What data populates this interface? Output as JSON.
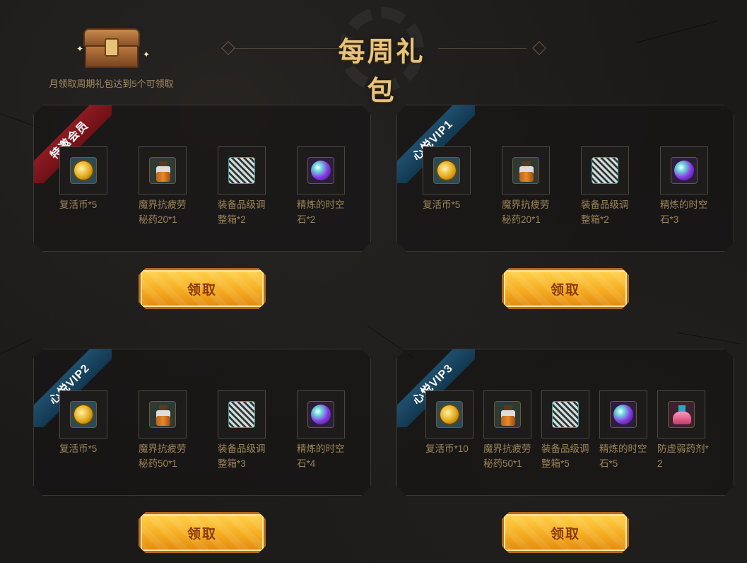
{
  "header": {
    "title": "每周礼包",
    "chest_note": "月领取周期礼包达到5个可领取"
  },
  "panels": [
    {
      "ribbon": "特邀会员",
      "ribbon_color": "#8e1b22",
      "items": [
        {
          "icon": "revive-coin-icon",
          "label": "复活币*5"
        },
        {
          "icon": "potion-icon",
          "label": "魔界抗疲劳秘药20*1"
        },
        {
          "icon": "gear-box-icon",
          "label": "装备品级调整箱*2"
        },
        {
          "icon": "time-stone-icon",
          "label": "精炼的时空石*2"
        }
      ],
      "button": "领取"
    },
    {
      "ribbon": "心悦VIP1",
      "ribbon_color": "#1f4f6d",
      "items": [
        {
          "icon": "revive-coin-icon",
          "label": "复活币*5"
        },
        {
          "icon": "potion-icon",
          "label": "魔界抗疲劳秘药20*1"
        },
        {
          "icon": "gear-box-icon",
          "label": "装备品级调整箱*2"
        },
        {
          "icon": "time-stone-icon",
          "label": "精炼的时空石*3"
        }
      ],
      "button": "领取"
    },
    {
      "ribbon": "心悦VIP2",
      "ribbon_color": "#1f4f6d",
      "items": [
        {
          "icon": "revive-coin-icon",
          "label": "复活币*5"
        },
        {
          "icon": "potion-icon",
          "label": "魔界抗疲劳秘药50*1"
        },
        {
          "icon": "gear-box-icon",
          "label": "装备品级调整箱*3"
        },
        {
          "icon": "time-stone-icon",
          "label": "精炼的时空石*4"
        }
      ],
      "button": "领取"
    },
    {
      "ribbon": "心悦VIP3",
      "ribbon_color": "#1f4f6d",
      "items": [
        {
          "icon": "revive-coin-icon",
          "label": "复活币*10"
        },
        {
          "icon": "potion-icon",
          "label": "魔界抗疲劳秘药50*1"
        },
        {
          "icon": "gear-box-icon",
          "label": "装备品级调整箱*5"
        },
        {
          "icon": "time-stone-icon",
          "label": "精炼的时空石*5"
        },
        {
          "icon": "weakness-flask-icon",
          "label": "防虚弱药剂*2"
        }
      ],
      "button": "领取"
    }
  ]
}
